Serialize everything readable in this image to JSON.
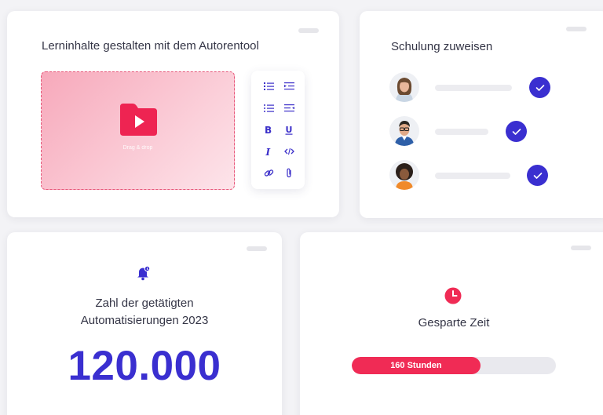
{
  "author_card": {
    "title": "Lerninhalte gestalten mit dem Autorentool",
    "dropzone_label": "Drag & drop",
    "toolbar_icons": [
      "ordered-list-icon",
      "indent-icon",
      "bullet-list-icon",
      "outdent-icon",
      "bold-icon",
      "underline-icon",
      "italic-icon",
      "code-icon",
      "link-icon",
      "attachment-icon"
    ]
  },
  "assign_card": {
    "title": "Schulung zuweisen",
    "rows": [
      {
        "avatar": "woman-avatar"
      },
      {
        "avatar": "man-glasses-avatar"
      },
      {
        "avatar": "woman-curly-avatar"
      }
    ]
  },
  "automation_card": {
    "label_line1": "Zahl der getätigten",
    "label_line2": "Automatisierungen 2023",
    "value": "120.000"
  },
  "time_card": {
    "title": "Gesparte Zeit",
    "progress_label": "160 Stunden",
    "progress_fraction": 0.63
  },
  "colors": {
    "accent": "#3a2fd0",
    "brand_red": "#f02b55",
    "dropzone_border": "#e7577a"
  }
}
